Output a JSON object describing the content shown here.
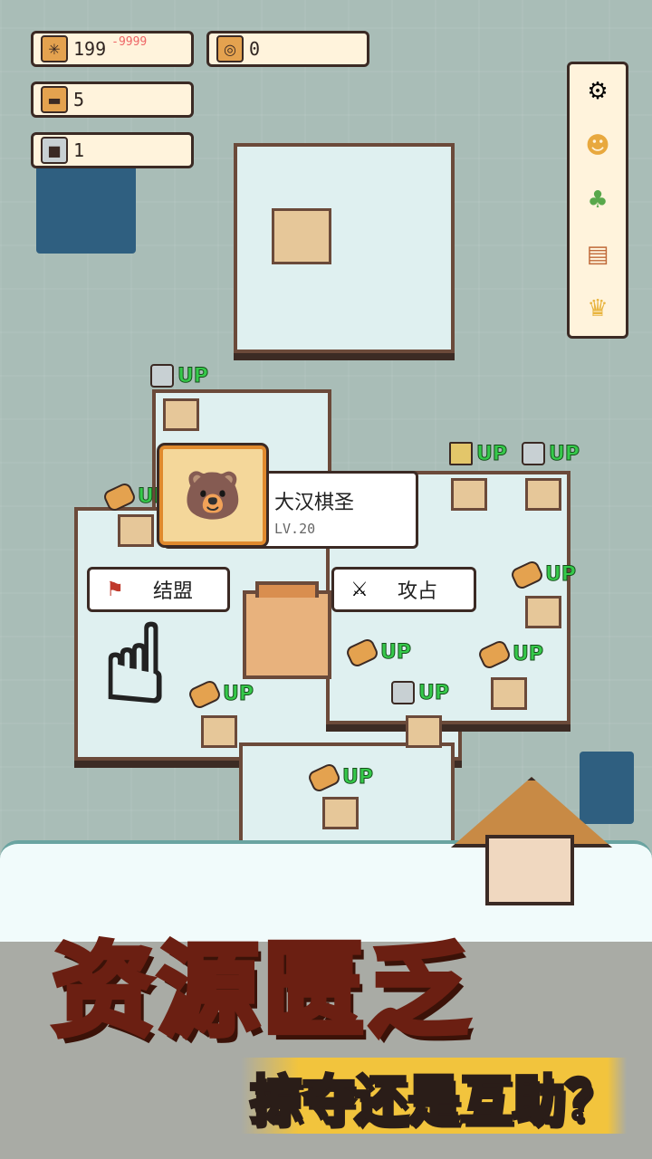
{
  "resources": {
    "wheat": {
      "icon": "wheat-icon",
      "value": "199",
      "delta": "-9999"
    },
    "coin": {
      "icon": "coin-icon",
      "value": "0"
    },
    "wood": {
      "icon": "wood-icon",
      "value": "5"
    },
    "stone": {
      "icon": "stone-icon",
      "value": "1"
    }
  },
  "side_menu": [
    "settings-icon",
    "character-icon",
    "tree-icon",
    "scroll-icon",
    "trophy-icon"
  ],
  "player": {
    "name": "大汉棋圣",
    "level": "LV.20"
  },
  "actions": {
    "alliance": "结盟",
    "attack": "攻占"
  },
  "upgrade_label": "UP",
  "banner": {
    "title_part1": "资源",
    "title_part2": "匮乏",
    "subtitle": "掠夺还是互助？"
  },
  "colors": {
    "up_text": "#35c94a",
    "title_blue": "#5fc7f0",
    "title_yellow": "#ffd83b"
  }
}
